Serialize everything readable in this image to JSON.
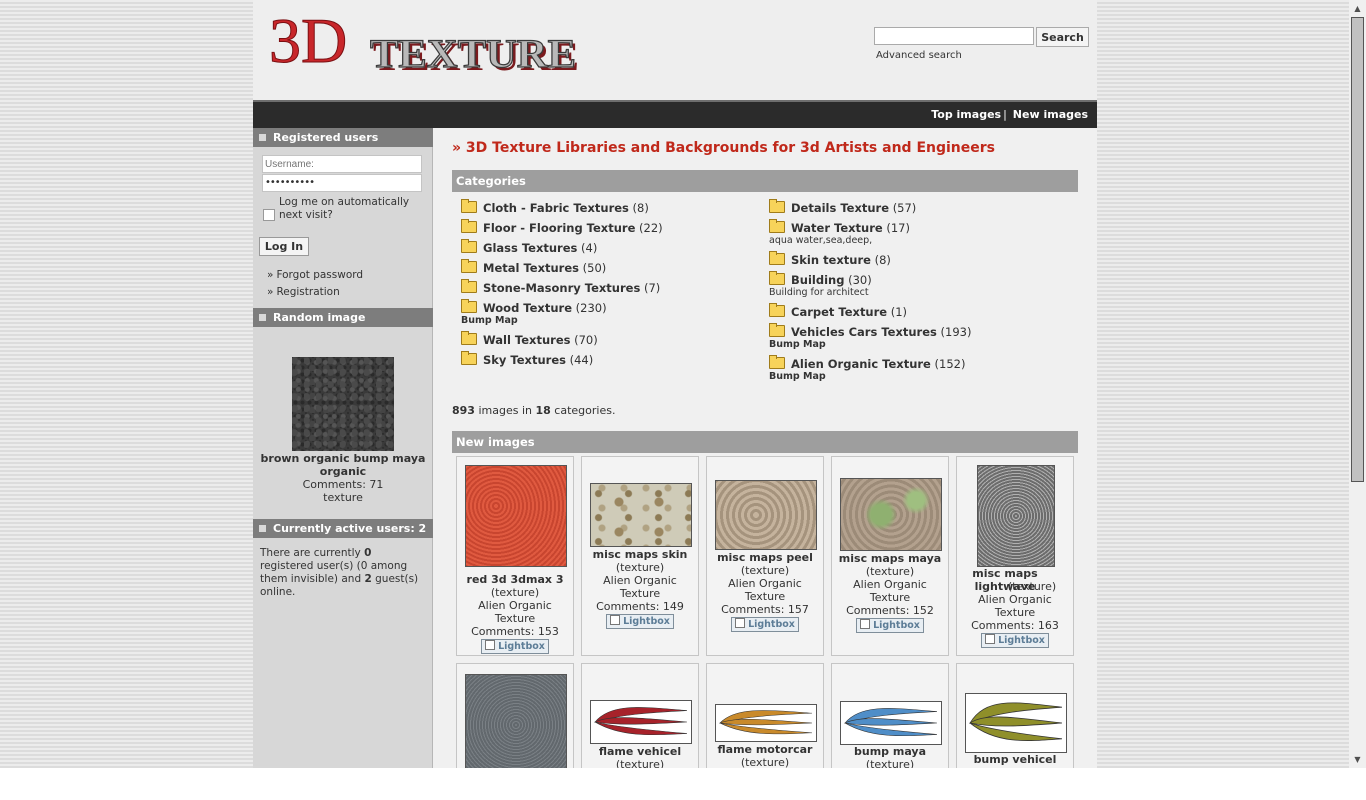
{
  "header": {
    "logo_alt": "3D TEXTURE",
    "logo_3d": "3D",
    "logo_word": "TEXTURE",
    "search_placeholder": "",
    "search_button": "Search",
    "advanced_search": "Advanced search"
  },
  "nav": {
    "top_images": "Top images",
    "separator": "|",
    "new_images": "New images"
  },
  "sidebar": {
    "registered_heading": "Registered users",
    "username_placeholder": "Username:",
    "password_value": "••••••••••",
    "remember_label": "Log me on automatically next visit?",
    "login_button": "Log In",
    "links_marker": "»",
    "forgot_password": "Forgot password",
    "registration": "Registration",
    "random_heading": "Random image",
    "random_title": "brown organic bump maya organic",
    "random_comments": "Comments: 71",
    "random_category": "texture",
    "active_heading": "Currently active users: 2",
    "active_text_1": "There are currently ",
    "active_registered": "0",
    "active_text_2": " registered user(s) (0 among them invisible) and ",
    "active_guests": "2",
    "active_text_3": " guest(s) online."
  },
  "content": {
    "heading": "» 3D Texture Libraries and Backgrounds for 3d Artists and Engineers",
    "categories_heading": "Categories",
    "categories_left": [
      {
        "name": "Cloth - Fabric Textures",
        "count": "(8)",
        "sub": ""
      },
      {
        "name": "Floor - Flooring Texture",
        "count": "(22)",
        "sub": ""
      },
      {
        "name": "Glass Textures",
        "count": "(4)",
        "sub": ""
      },
      {
        "name": "Metal Textures",
        "count": "(50)",
        "sub": ""
      },
      {
        "name": "Stone-Masonry Textures",
        "count": "(7)",
        "sub": ""
      },
      {
        "name": "Wood Texture",
        "count": "(230)",
        "sub": "Bump Map"
      },
      {
        "name": "Wall Textures",
        "count": "(70)",
        "sub": ""
      },
      {
        "name": "Sky Textures",
        "count": "(44)",
        "sub": ""
      }
    ],
    "categories_right": [
      {
        "name": "Details Texture",
        "count": "(57)",
        "sub": ""
      },
      {
        "name": "Water Texture",
        "count": "(17)",
        "sub": "aqua water,sea,deep,"
      },
      {
        "name": "Skin texture",
        "count": "(8)",
        "sub": ""
      },
      {
        "name": "Building",
        "count": "(30)",
        "sub": "Building for architect"
      },
      {
        "name": "Carpet Texture",
        "count": "(1)",
        "sub": ""
      },
      {
        "name": "Vehicles Cars Textures",
        "count": "(193)",
        "sub": "Bump Map"
      },
      {
        "name": "Alien Organic Texture",
        "count": "(152)",
        "sub": "Bump Map"
      }
    ],
    "stats_images": "893",
    "stats_mid": " images in ",
    "stats_categories": "18",
    "stats_end": " categories.",
    "new_images_heading": "New images",
    "lightbox_label": "Lightbox",
    "new_images": [
      {
        "title": "red 3d 3dmax 3",
        "type": "(texture)",
        "category": "Alien Organic Texture",
        "comments": "Comments: 153"
      },
      {
        "title": "misc maps skin",
        "type": "(texture)",
        "category": "Alien Organic Texture",
        "comments": "Comments: 149"
      },
      {
        "title": "misc maps peel",
        "type": "(texture)",
        "category": "Alien Organic Texture",
        "comments": "Comments: 157"
      },
      {
        "title": "misc maps maya",
        "type": "(texture)",
        "category": "Alien Organic Texture",
        "comments": "Comments: 152"
      },
      {
        "title": "misc maps lightwave",
        "type": "(texture)",
        "category": "Alien Organic Texture",
        "comments": "Comments: 163"
      },
      {
        "title": "",
        "type": "",
        "category": "",
        "comments": ""
      },
      {
        "title": "flame vehicel",
        "type": "(texture)",
        "category": "",
        "comments": ""
      },
      {
        "title": "flame motorcar",
        "type": "(texture)",
        "category": "",
        "comments": ""
      },
      {
        "title": "bump maya",
        "type": "(texture)",
        "category": "",
        "comments": ""
      },
      {
        "title": "bump vehicel",
        "type": "",
        "category": "",
        "comments": ""
      }
    ]
  },
  "colors": {
    "heading_red": "#c0291b",
    "navbar": "#2b2b2b",
    "section_bar": "#9e9e9e",
    "sidebar_head": "#7d7d7d"
  }
}
